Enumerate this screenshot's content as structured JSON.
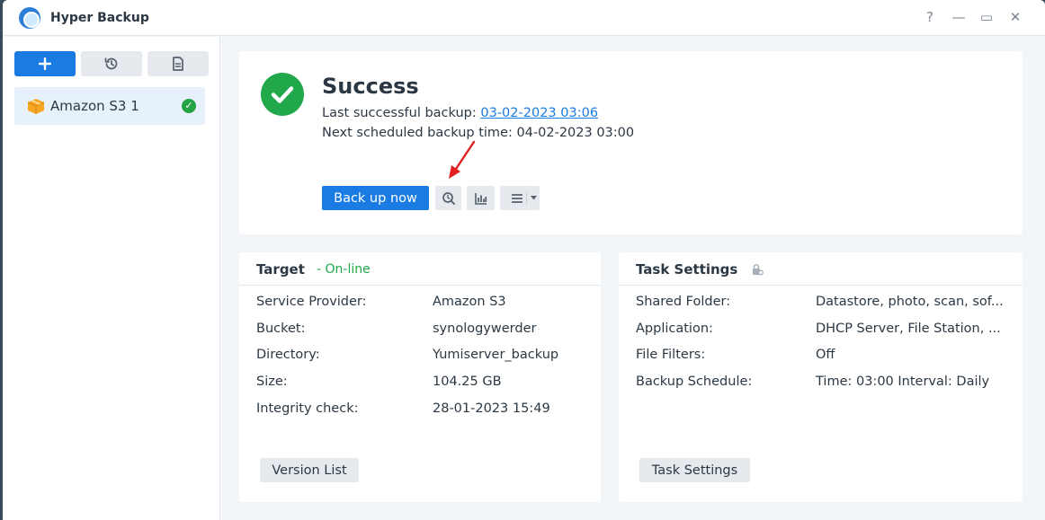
{
  "window": {
    "title": "Hyper Backup"
  },
  "titlebar": {
    "help": "?",
    "minimize": "—",
    "maximize": "▭",
    "close": "✕"
  },
  "sidebar": {
    "tasks": [
      {
        "label": "Amazon S3 1",
        "status": "success"
      }
    ]
  },
  "status": {
    "title": "Success",
    "last_label": "Last successful backup: ",
    "last_value": "03-02-2023 03:06",
    "next_line": "Next scheduled backup time: 04-02-2023 03:00",
    "backup_now": "Back up now"
  },
  "target": {
    "title": "Target",
    "state": "- On-line",
    "rows": [
      {
        "label": "Service Provider:",
        "value": "Amazon S3"
      },
      {
        "label": "Bucket:",
        "value": "synologywerder"
      },
      {
        "label": "Directory:",
        "value": "Yumiserver_backup"
      },
      {
        "label": "Size:",
        "value": "104.25 GB"
      },
      {
        "label": "Integrity check:",
        "value": "28-01-2023 15:49"
      }
    ],
    "button": "Version List"
  },
  "settings": {
    "title": "Task Settings",
    "rows": [
      {
        "label": "Shared Folder:",
        "value": "Datastore, photo, scan, sof..."
      },
      {
        "label": "Application:",
        "value": "DHCP Server, File Station, ..."
      },
      {
        "label": "File Filters:",
        "value": "Off"
      },
      {
        "label": "Backup Schedule:",
        "value": "Time: 03:00 Interval: Daily"
      }
    ],
    "button": "Task Settings"
  },
  "colors": {
    "accent": "#1a7be2",
    "success": "#21a84a",
    "annotation_arrow": "#e02020"
  }
}
